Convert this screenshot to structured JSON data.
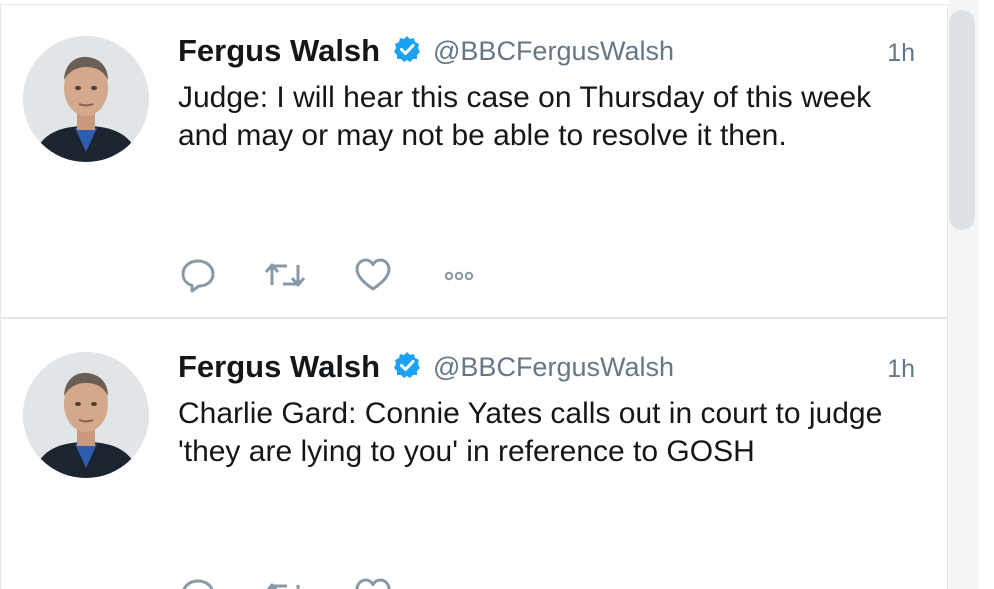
{
  "tweets": [
    {
      "author": "Fergus Walsh",
      "handle": "@BBCFergusWalsh",
      "time": "1h",
      "text": "Judge: I will hear this case on Thursday of this week and may or may not be able to resolve it then.",
      "icons": {
        "avatar": "avatar-photo",
        "verified": "verified-badge-icon",
        "reply": "reply-icon",
        "retweet": "retweet-icon",
        "like": "heart-icon",
        "more": "more-dots-icon"
      }
    },
    {
      "author": "Fergus Walsh",
      "handle": "@BBCFergusWalsh",
      "time": "1h",
      "text": "Charlie Gard: Connie Yates calls out in court to judge 'they are lying to you' in reference to GOSH",
      "icons": {
        "avatar": "avatar-photo",
        "verified": "verified-badge-icon",
        "reply": "reply-icon",
        "retweet": "retweet-icon",
        "like": "heart-icon",
        "more": "more-dots-icon"
      }
    }
  ],
  "colors": {
    "text": "#14171a",
    "secondary": "#657786",
    "verified": "#1da1f2",
    "divider": "#e1e8ed",
    "action_icon": "#8899a6"
  }
}
